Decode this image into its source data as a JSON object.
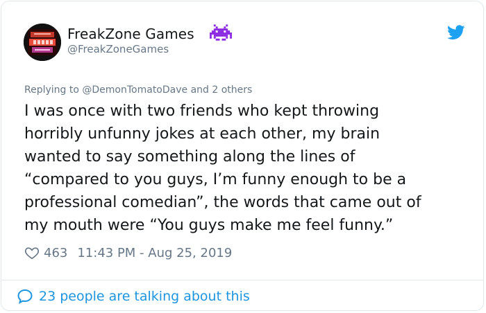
{
  "author": {
    "name": "FreakZone Games",
    "handle": "@FreakZoneGames",
    "avatar_logo_text": "FREAK ZONE GAMES"
  },
  "reply": {
    "prefix": "Replying to ",
    "to": "@DemonTomatoDave",
    "suffix": " and 2 others"
  },
  "tweet": {
    "text": "I was once with two friends who kept throwing\nhorribly unfunny jokes at each other, my brain\nwanted to say something along the lines of\n“compared to you guys, I’m funny enough to be a\nprofessional comedian”, the words that came out of\nmy mouth were “You guys make me feel funny.”"
  },
  "meta": {
    "likes": "463",
    "timestamp": "11:43 PM - Aug 25, 2019"
  },
  "footer": {
    "talking": "23 people are talking about this"
  },
  "colors": {
    "accent": "#1b95e0",
    "muted": "#657786",
    "text": "#14171a",
    "invader": "#8b2be2"
  },
  "icons": [
    "space-invader-icon",
    "twitter-bird-icon",
    "heart-icon",
    "speech-bubble-icon"
  ]
}
